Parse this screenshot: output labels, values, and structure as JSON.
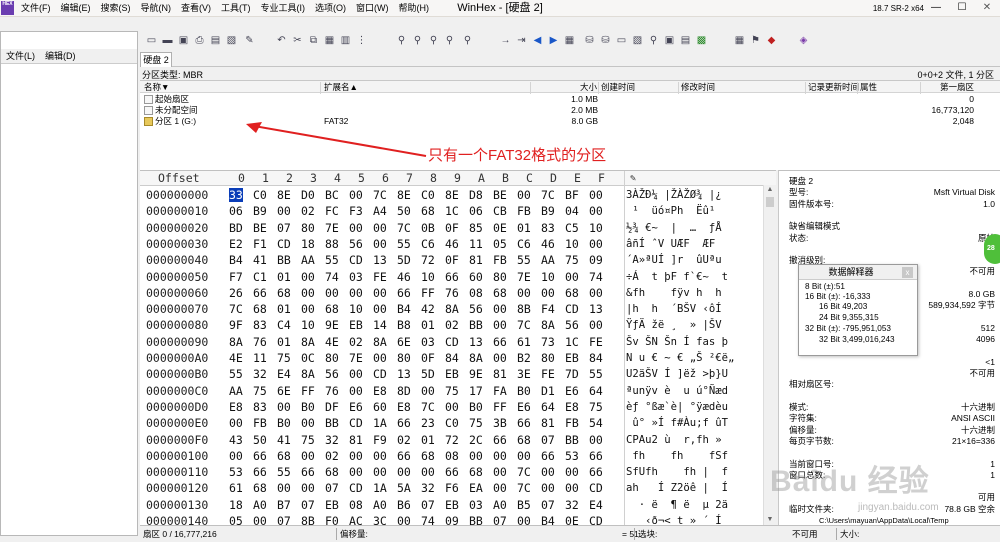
{
  "titlebar": {
    "app_icon": "HEX",
    "menus": [
      "文件(F)",
      "编辑(E)",
      "搜索(S)",
      "导航(N)",
      "查看(V)",
      "工具(T)",
      "专业工具(I)",
      "选项(O)",
      "窗口(W)",
      "帮助(H)"
    ],
    "title": "WinHex - [硬盘 2]",
    "version": "18.7 SR-2 x64",
    "min_glyph": "—",
    "max_glyph": "☐",
    "close_glyph": "✕"
  },
  "left_panel": {
    "menus": [
      "文件(L)",
      "编辑(D)"
    ]
  },
  "tab": {
    "label": "硬盘 2"
  },
  "partition": {
    "type_label": "分区类型: MBR",
    "summary": "0+0+2 文件, 1 分区",
    "columns": [
      "名称▼",
      "扩展名▲",
      "大小",
      "创建时间",
      "修改时间",
      "记录更新时间",
      "属性",
      "第一扇区"
    ],
    "rows": [
      {
        "name": "起始扇区",
        "ext": "",
        "size": "1.0 MB",
        "first_sector": "0"
      },
      {
        "name": "未分配空间",
        "ext": "",
        "size": "2.0 MB",
        "first_sector": "16,773,120"
      },
      {
        "name": "分区 1 (G:)",
        "ext": "FAT32",
        "size": "8.0 GB",
        "first_sector": "2,048"
      }
    ]
  },
  "annotation": {
    "text": "只有一个FAT32格式的分区",
    "color": "#e02020"
  },
  "hex": {
    "offset_header": "Offset",
    "col_headers": [
      "0",
      "1",
      "2",
      "3",
      "4",
      "5",
      "6",
      "7",
      "8",
      "9",
      "A",
      "B",
      "C",
      "D",
      "E",
      "F"
    ],
    "rows": [
      {
        "offset": "000000000",
        "bytes": [
          "33",
          "C0",
          "8E",
          "D0",
          "BC",
          "00",
          "7C",
          "8E",
          "C0",
          "8E",
          "D8",
          "BE",
          "00",
          "7C",
          "BF",
          "00"
        ],
        "ascii": "3ÀŽĐ¼ |ŽÀŽØ¾ |¿"
      },
      {
        "offset": "000000010",
        "bytes": [
          "06",
          "B9",
          "00",
          "02",
          "FC",
          "F3",
          "A4",
          "50",
          "68",
          "1C",
          "06",
          "CB",
          "FB",
          "B9",
          "04",
          "00"
        ],
        "ascii": " ¹  üó¤Ph  Ëû¹"
      },
      {
        "offset": "000000020",
        "bytes": [
          "BD",
          "BE",
          "07",
          "80",
          "7E",
          "00",
          "00",
          "7C",
          "0B",
          "0F",
          "85",
          "0E",
          "01",
          "83",
          "C5",
          "10"
        ],
        "ascii": "½¾ €~  |  …  ƒÅ"
      },
      {
        "offset": "000000030",
        "bytes": [
          "E2",
          "F1",
          "CD",
          "18",
          "88",
          "56",
          "00",
          "55",
          "C6",
          "46",
          "11",
          "05",
          "C6",
          "46",
          "10",
          "00"
        ],
        "ascii": "âñÍ ˆV UÆF  ÆF"
      },
      {
        "offset": "000000040",
        "bytes": [
          "B4",
          "41",
          "BB",
          "AA",
          "55",
          "CD",
          "13",
          "5D",
          "72",
          "0F",
          "81",
          "FB",
          "55",
          "AA",
          "75",
          "09"
        ],
        "ascii": "´A»ªUÍ ]r  ûUªu"
      },
      {
        "offset": "000000050",
        "bytes": [
          "F7",
          "C1",
          "01",
          "00",
          "74",
          "03",
          "FE",
          "46",
          "10",
          "66",
          "60",
          "80",
          "7E",
          "10",
          "00",
          "74"
        ],
        "ascii": "÷Á  t þF f`€~  t"
      },
      {
        "offset": "000000060",
        "bytes": [
          "26",
          "66",
          "68",
          "00",
          "00",
          "00",
          "00",
          "66",
          "FF",
          "76",
          "08",
          "68",
          "00",
          "00",
          "68",
          "00"
        ],
        "ascii": "&fh    fÿv h  h"
      },
      {
        "offset": "000000070",
        "bytes": [
          "7C",
          "68",
          "01",
          "00",
          "68",
          "10",
          "00",
          "B4",
          "42",
          "8A",
          "56",
          "00",
          "8B",
          "F4",
          "CD",
          "13"
        ],
        "ascii": "|h  h  ´BŠV ‹ôÍ"
      },
      {
        "offset": "000000080",
        "bytes": [
          "9F",
          "83",
          "C4",
          "10",
          "9E",
          "EB",
          "14",
          "B8",
          "01",
          "02",
          "BB",
          "00",
          "7C",
          "8A",
          "56",
          "00"
        ],
        "ascii": "ŸƒÄ žë ¸  » |ŠV"
      },
      {
        "offset": "000000090",
        "bytes": [
          "8A",
          "76",
          "01",
          "8A",
          "4E",
          "02",
          "8A",
          "6E",
          "03",
          "CD",
          "13",
          "66",
          "61",
          "73",
          "1C",
          "FE"
        ],
        "ascii": "Šv ŠN Šn Í fas þ"
      },
      {
        "offset": "0000000A0",
        "bytes": [
          "4E",
          "11",
          "75",
          "0C",
          "80",
          "7E",
          "00",
          "80",
          "0F",
          "84",
          "8A",
          "00",
          "B2",
          "80",
          "EB",
          "84"
        ],
        "ascii": "N u € ~ € „Š ²€ë„"
      },
      {
        "offset": "0000000B0",
        "bytes": [
          "55",
          "32",
          "E4",
          "8A",
          "56",
          "00",
          "CD",
          "13",
          "5D",
          "EB",
          "9E",
          "81",
          "3E",
          "FE",
          "7D",
          "55"
        ],
        "ascii": "U2äŠV Í ]ëž >þ}U"
      },
      {
        "offset": "0000000C0",
        "bytes": [
          "AA",
          "75",
          "6E",
          "FF",
          "76",
          "00",
          "E8",
          "8D",
          "00",
          "75",
          "17",
          "FA",
          "B0",
          "D1",
          "E6",
          "64"
        ],
        "ascii": "ªunÿv è  u ú°Ñæd"
      },
      {
        "offset": "0000000D0",
        "bytes": [
          "E8",
          "83",
          "00",
          "B0",
          "DF",
          "E6",
          "60",
          "E8",
          "7C",
          "00",
          "B0",
          "FF",
          "E6",
          "64",
          "E8",
          "75"
        ],
        "ascii": "èƒ °ßæ`è| °ÿædèu"
      },
      {
        "offset": "0000000E0",
        "bytes": [
          "00",
          "FB",
          "B0",
          "00",
          "BB",
          "CD",
          "1A",
          "66",
          "23",
          "C0",
          "75",
          "3B",
          "66",
          "81",
          "FB",
          "54"
        ],
        "ascii": " û° »Í f#Àu;f ûT"
      },
      {
        "offset": "0000000F0",
        "bytes": [
          "43",
          "50",
          "41",
          "75",
          "32",
          "81",
          "F9",
          "02",
          "01",
          "72",
          "2C",
          "66",
          "68",
          "07",
          "BB",
          "00"
        ],
        "ascii": "CPAu2 ù  r,fh »"
      },
      {
        "offset": "000000100",
        "bytes": [
          "00",
          "66",
          "68",
          "00",
          "02",
          "00",
          "00",
          "66",
          "68",
          "08",
          "00",
          "00",
          "00",
          "66",
          "53",
          "66"
        ],
        "ascii": " fh    fh    fSf"
      },
      {
        "offset": "000000110",
        "bytes": [
          "53",
          "66",
          "55",
          "66",
          "68",
          "00",
          "00",
          "00",
          "00",
          "66",
          "68",
          "00",
          "7C",
          "00",
          "00",
          "66"
        ],
        "ascii": "SfUfh    fh |  f"
      },
      {
        "offset": "000000120",
        "bytes": [
          "61",
          "68",
          "00",
          "00",
          "07",
          "CD",
          "1A",
          "5A",
          "32",
          "F6",
          "EA",
          "00",
          "7C",
          "00",
          "00",
          "CD"
        ],
        "ascii": "ah   Í Z2öê |  Í"
      },
      {
        "offset": "000000130",
        "bytes": [
          "18",
          "A0",
          "B7",
          "07",
          "EB",
          "08",
          "A0",
          "B6",
          "07",
          "EB",
          "03",
          "A0",
          "B5",
          "07",
          "32",
          "E4"
        ],
        "ascii": "  · ë  ¶ ë  µ 2ä"
      },
      {
        "offset": "000000140",
        "bytes": [
          "05",
          "00",
          "07",
          "8B",
          "F0",
          "AC",
          "3C",
          "00",
          "74",
          "09",
          "BB",
          "07",
          "00",
          "B4",
          "0E",
          "CD"
        ],
        "ascii": "   ‹ð¬< t » ´ Í"
      }
    ]
  },
  "info_panel": {
    "rows": [
      {
        "k": "硬盘 2",
        "v": ""
      },
      {
        "k": "型号:",
        "v": "Msft Virtual Disk"
      },
      {
        "k": "固件版本号:",
        "v": "1.0"
      },
      {
        "k": "",
        "v": ""
      },
      {
        "k": "缺省编辑模式",
        "v": ""
      },
      {
        "k": "状态:",
        "v": "原始"
      },
      {
        "k": "",
        "v": ""
      },
      {
        "k": "撤消级别:",
        "v": ""
      },
      {
        "k": "",
        "v": "不可用"
      },
      {
        "k": "",
        "v": ""
      },
      {
        "k": "",
        "v": "8.0 GB"
      },
      {
        "k": "",
        "v": "589,934,592 字节"
      },
      {
        "k": "",
        "v": ""
      },
      {
        "k": "",
        "v": "512"
      },
      {
        "k": "",
        "v": "4096"
      },
      {
        "k": "",
        "v": ""
      },
      {
        "k": "",
        "v": "<1"
      },
      {
        "k": "",
        "v": "不可用"
      },
      {
        "k": "相对扇区号:",
        "v": ""
      },
      {
        "k": "",
        "v": ""
      },
      {
        "k": "模式:",
        "v": "十六进制"
      },
      {
        "k": "字符集:",
        "v": "ANSI ASCII"
      },
      {
        "k": "偏移量:",
        "v": "十六进制"
      },
      {
        "k": "每页字节数:",
        "v": "21×16=336"
      },
      {
        "k": "",
        "v": ""
      },
      {
        "k": "当前窗口号:",
        "v": "1"
      },
      {
        "k": "窗口总数:",
        "v": "1"
      },
      {
        "k": "",
        "v": ""
      },
      {
        "k": "",
        "v": "可用"
      },
      {
        "k": "临时文件夹:",
        "v": "78.8 GB 空余"
      },
      {
        "k": "C:\\Users\\mayuan\\AppData\\Local\\Temp",
        "v": ""
      }
    ]
  },
  "interpreter": {
    "title": "数据解释器",
    "close": "x",
    "rows": [
      "8 Bit (±):51",
      "16 Bit (±): -16,333",
      "16 Bit 49,203",
      "24 Bit 9,355,315",
      "32 Bit (±): -795,951,053",
      "32 Bit 3,499,016,243"
    ]
  },
  "status": {
    "sector": "扇区 0 / 16,777,216",
    "offset_label": "偏移量:",
    "value": "= 51",
    "select": "选块:",
    "na": "不可用",
    "size": "大小:"
  },
  "watermark": {
    "text": "Baidu 经验",
    "sub": "jingyan.baidu.com"
  },
  "badge": {
    "text": "28"
  }
}
